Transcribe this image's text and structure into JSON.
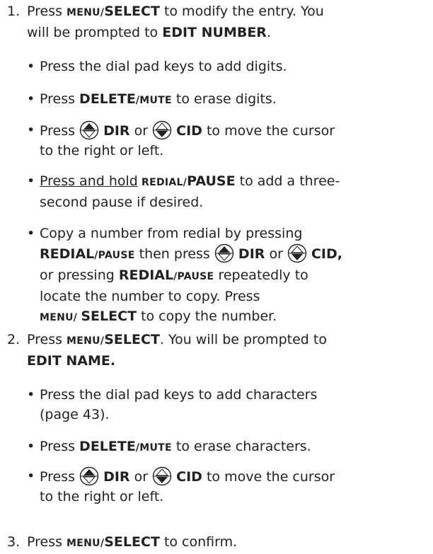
{
  "steps": [
    {
      "number": "1.",
      "l1a": "Press ",
      "key1_small": "MENU/",
      "key1_large": "SELECT",
      "l1b": " to modify the entry. You",
      "l2a": "will be prompted to ",
      "l2b": "EDIT NUMBER",
      "l2c": ".",
      "bullets": [
        {
          "text": "Press the dial pad keys to add digits."
        },
        {
          "a": "Press ",
          "k_large": "DELETE",
          "k_small": "/MUTE",
          "b": " to erase digits."
        },
        {
          "a": "Press ",
          "dir": "DIR",
          "or": " or ",
          "cid": "CID",
          "b": " to move the cursor",
          "l2": "to the right or left."
        },
        {
          "u": "Press and hold",
          "k_small": " REDIAL/",
          "k_large": "PAUSE",
          "b": " to add a three-",
          "l2": "second pause if desired."
        },
        {
          "l1": "Copy a number from redial by pressing",
          "l2_k_large": "REDIAL",
          "l2_k_small": "/PAUSE",
          "l2_a": " then press ",
          "dir": "DIR",
          "or": " or ",
          "cid": "CID,",
          "l3_a": "or pressing ",
          "l3_k_large": "REDIAL",
          "l3_k_small": "/PAUSE",
          "l3_b": " repeatedly to",
          "l4": "locate the number to copy. Press",
          "l5_k_small": "MENU/ ",
          "l5_k_large": "SELECT",
          "l5_b": " to copy the number."
        }
      ]
    },
    {
      "number": "2.",
      "l1a": "Press ",
      "key1_small": "MENU/",
      "key1_large": "SELECT",
      "l1b": ". You will be prompted to",
      "l2b": "EDIT NAME.",
      "bullets": [
        {
          "l1": "Press the dial pad keys to add characters",
          "l2": "(page 43)."
        },
        {
          "a": "Press ",
          "k_large": "DELETE",
          "k_small": "/MUTE",
          "b": " to erase characters."
        },
        {
          "a": "Press ",
          "dir": "DIR",
          "or": " or ",
          "cid": "CID",
          "b": " to move the cursor",
          "l2": "to the right or left."
        }
      ]
    },
    {
      "number": "3.",
      "l1a": "Press ",
      "key1_small": "MENU/",
      "key1_large": "SELECT",
      "l1b": " to confirm."
    }
  ],
  "icons": {
    "up": "dir-up-arrow-icon",
    "down": "cid-down-arrow-icon"
  }
}
